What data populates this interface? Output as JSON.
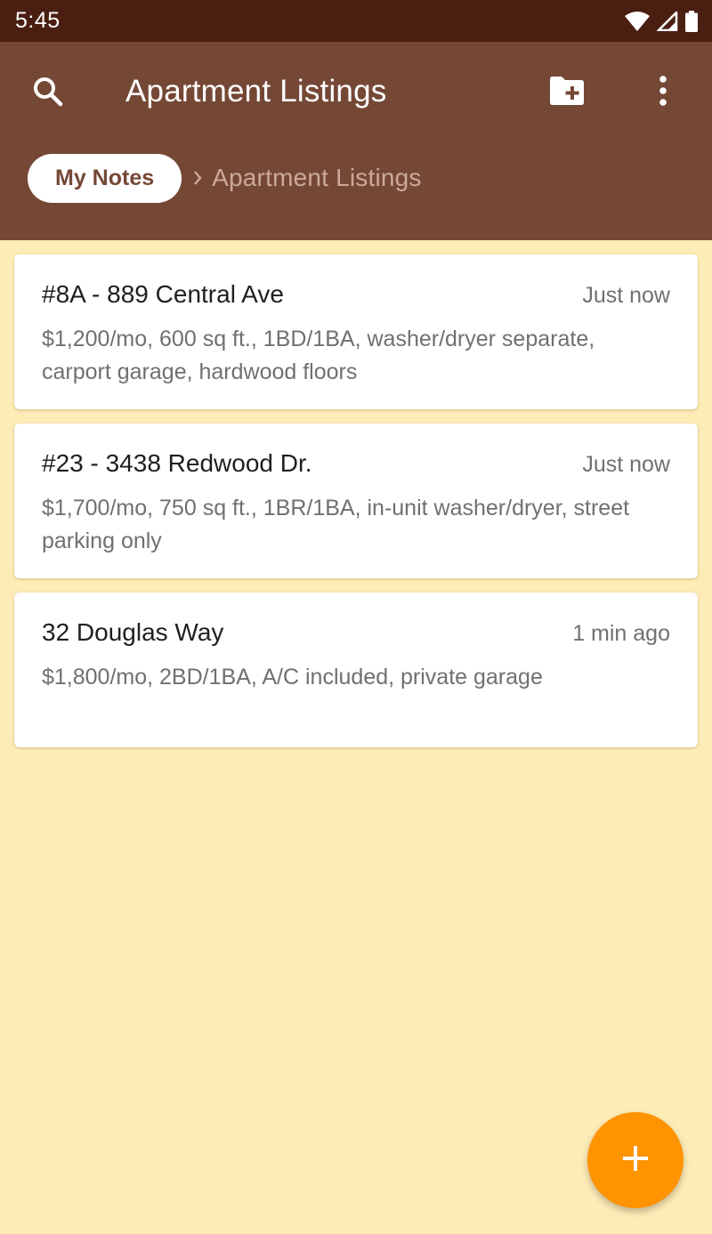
{
  "status_bar": {
    "time": "5:45",
    "icons": [
      "wifi-icon",
      "cell-signal-icon",
      "battery-icon"
    ]
  },
  "toolbar": {
    "title": "Apartment Listings",
    "icons": [
      "search-icon",
      "new-folder-icon",
      "more-vert-icon"
    ]
  },
  "breadcrumb": {
    "root": "My Notes",
    "separator_icon": "chevron-right-icon",
    "current": "Apartment Listings"
  },
  "notes": [
    {
      "title": "#8A - 889 Central Ave",
      "time": "Just now",
      "body": "$1,200/mo, 600 sq ft., 1BD/1BA, washer/dryer separate, carport garage, hardwood floors"
    },
    {
      "title": "#23 - 3438 Redwood Dr.",
      "time": "Just now",
      "body": "$1,700/mo, 750 sq ft., 1BR/1BA, in-unit washer/dryer, street parking only"
    },
    {
      "title": "32 Douglas Way",
      "time": "1 min ago",
      "body": "$1,800/mo, 2BD/1BA, A/C included, private garage"
    }
  ],
  "fab": {
    "icon": "plus-icon"
  },
  "colors": {
    "status_bar": "#4a1f12",
    "app_bar": "#754836",
    "background": "#feecb6",
    "fab": "#ff9300",
    "card": "#ffffff"
  }
}
